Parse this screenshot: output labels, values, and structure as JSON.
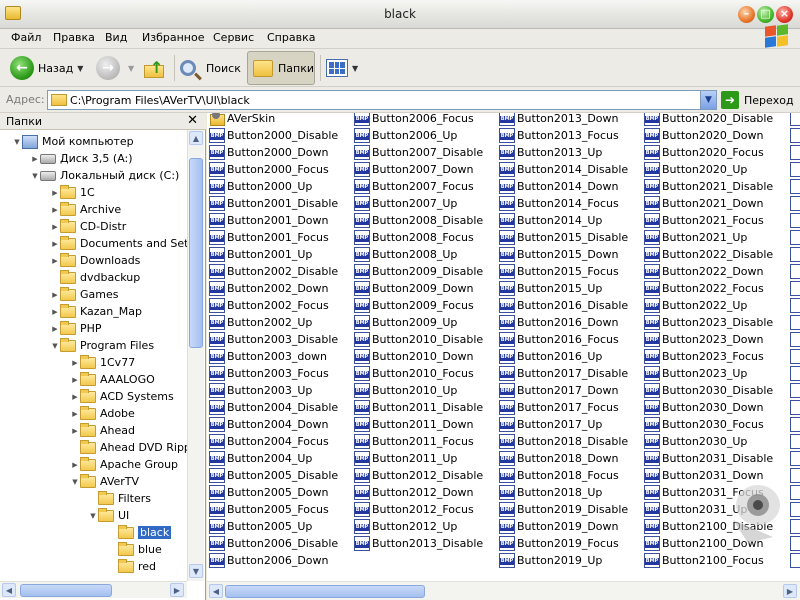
{
  "window": {
    "title": "black"
  },
  "menu": [
    "Файл",
    "Правка",
    "Вид",
    "Избранное",
    "Сервис",
    "Справка"
  ],
  "toolbar": {
    "back": "Назад",
    "search": "Поиск",
    "folders": "Папки"
  },
  "address": {
    "label": "Адрес:",
    "path": "C:\\Program Files\\AVerTV\\UI\\black",
    "go": "Переход"
  },
  "folders_pane": {
    "title": "Папки",
    "close": "✕",
    "tree": [
      {
        "label": "Мой компьютер",
        "level": 0,
        "exp": "▼",
        "icon": "computer-icon"
      },
      {
        "label": "Диск 3,5 (A:)",
        "level": 1,
        "exp": "▶",
        "icon": "floppy-drive-icon"
      },
      {
        "label": "Локальный диск (C:)",
        "level": 1,
        "exp": "▼",
        "icon": "hard-drive-icon"
      },
      {
        "label": "1C",
        "level": 2,
        "exp": "▶",
        "icon": "folder-icon"
      },
      {
        "label": "Archive",
        "level": 2,
        "exp": "▶",
        "icon": "folder-icon"
      },
      {
        "label": "CD-Distr",
        "level": 2,
        "exp": "▶",
        "icon": "folder-icon"
      },
      {
        "label": "Documents and Settin",
        "level": 2,
        "exp": "▶",
        "icon": "folder-icon"
      },
      {
        "label": "Downloads",
        "level": 2,
        "exp": "▶",
        "icon": "folder-icon"
      },
      {
        "label": "dvdbackup",
        "level": 2,
        "exp": "",
        "icon": "folder-icon"
      },
      {
        "label": "Games",
        "level": 2,
        "exp": "▶",
        "icon": "folder-icon"
      },
      {
        "label": "Kazan_Map",
        "level": 2,
        "exp": "▶",
        "icon": "folder-icon"
      },
      {
        "label": "PHP",
        "level": 2,
        "exp": "▶",
        "icon": "folder-icon"
      },
      {
        "label": "Program Files",
        "level": 2,
        "exp": "▼",
        "icon": "folder-icon"
      },
      {
        "label": "1Cv77",
        "level": 3,
        "exp": "▶",
        "icon": "folder-icon"
      },
      {
        "label": "AAALOGO",
        "level": 3,
        "exp": "▶",
        "icon": "folder-icon"
      },
      {
        "label": "ACD Systems",
        "level": 3,
        "exp": "▶",
        "icon": "folder-icon"
      },
      {
        "label": "Adobe",
        "level": 3,
        "exp": "▶",
        "icon": "folder-icon"
      },
      {
        "label": "Ahead",
        "level": 3,
        "exp": "▶",
        "icon": "folder-icon"
      },
      {
        "label": "Ahead DVD Ripper",
        "level": 3,
        "exp": "",
        "icon": "folder-icon"
      },
      {
        "label": "Apache Group",
        "level": 3,
        "exp": "▶",
        "icon": "folder-icon"
      },
      {
        "label": "AVerTV",
        "level": 3,
        "exp": "▼",
        "icon": "folder-icon"
      },
      {
        "label": "Filters",
        "level": 4,
        "exp": "",
        "icon": "folder-icon"
      },
      {
        "label": "UI",
        "level": 4,
        "exp": "▼",
        "icon": "folder-icon"
      },
      {
        "label": "black",
        "level": 5,
        "exp": "",
        "icon": "folder-icon",
        "selected": true
      },
      {
        "label": "blue",
        "level": 5,
        "exp": "",
        "icon": "folder-icon"
      },
      {
        "label": "red",
        "level": 5,
        "exp": "",
        "icon": "folder-icon"
      }
    ]
  },
  "files": {
    "columns": [
      [
        "AVerSkin",
        "Button2000_Disable",
        "Button2000_Down",
        "Button2000_Focus",
        "Button2000_Up",
        "Button2001_Disable",
        "Button2001_Down",
        "Button2001_Focus",
        "Button2001_Up",
        "Button2002_Disable",
        "Button2002_Down",
        "Button2002_Focus",
        "Button2002_Up",
        "Button2003_Disable",
        "Button2003_down",
        "Button2003_Focus",
        "Button2003_Up",
        "Button2004_Disable",
        "Button2004_Down",
        "Button2004_Focus",
        "Button2004_Up",
        "Button2005_Disable",
        "Button2005_Down",
        "Button2005_Focus",
        "Button2005_Up",
        "Button2006_Disable",
        "Button2006_Down"
      ],
      [
        "Button2006_Focus",
        "Button2006_Up",
        "Button2007_Disable",
        "Button2007_Down",
        "Button2007_Focus",
        "Button2007_Up",
        "Button2008_Disable",
        "Button2008_Focus",
        "Button2008_Up",
        "Button2009_Disable",
        "Button2009_Down",
        "Button2009_Focus",
        "Button2009_Up",
        "Button2010_Disable",
        "Button2010_Down",
        "Button2010_Focus",
        "Button2010_Up",
        "Button2011_Disable",
        "Button2011_Down",
        "Button2011_Focus",
        "Button2011_Up",
        "Button2012_Disable",
        "Button2012_Down",
        "Button2012_Focus",
        "Button2012_Up",
        "Button2013_Disable"
      ],
      [
        "Button2013_Down",
        "Button2013_Focus",
        "Button2013_Up",
        "Button2014_Disable",
        "Button2014_Down",
        "Button2014_Focus",
        "Button2014_Up",
        "Button2015_Disable",
        "Button2015_Down",
        "Button2015_Focus",
        "Button2015_Up",
        "Button2016_Disable",
        "Button2016_Down",
        "Button2016_Focus",
        "Button2016_Up",
        "Button2017_Disable",
        "Button2017_Down",
        "Button2017_Focus",
        "Button2017_Up",
        "Button2018_Disable",
        "Button2018_Down",
        "Button2018_Focus",
        "Button2018_Up",
        "Button2019_Disable",
        "Button2019_Down",
        "Button2019_Focus",
        "Button2019_Up"
      ],
      [
        "Button2020_Disable",
        "Button2020_Down",
        "Button2020_Focus",
        "Button2020_Up",
        "Button2021_Disable",
        "Button2021_Down",
        "Button2021_Focus",
        "Button2021_Up",
        "Button2022_Disable",
        "Button2022_Down",
        "Button2022_Focus",
        "Button2022_Up",
        "Button2023_Disable",
        "Button2023_Down",
        "Button2023_Focus",
        "Button2023_Up",
        "Button2030_Disable",
        "Button2030_Down",
        "Button2030_Focus",
        "Button2030_Up",
        "Button2031_Disable",
        "Button2031_Down",
        "Button2031_Focus",
        "Button2031_Up",
        "Button2100_Disable",
        "Button2100_Down",
        "Button2100_Focus"
      ]
    ]
  }
}
